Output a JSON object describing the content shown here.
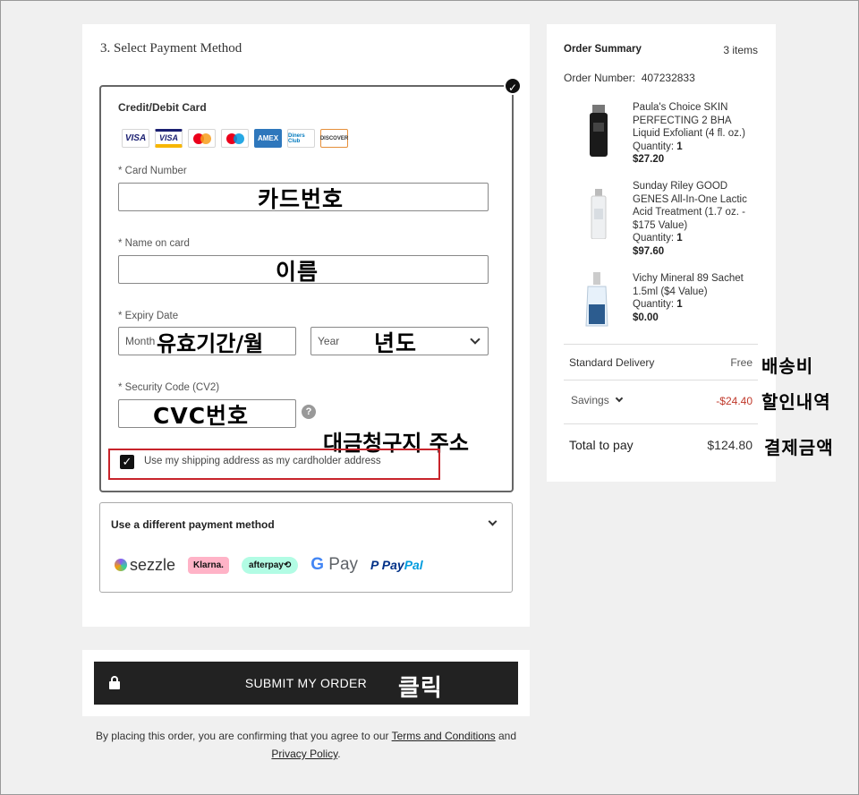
{
  "payment": {
    "section_title": "3. Select Payment Method",
    "card": {
      "title": "Credit/Debit Card",
      "logos": [
        "VISA",
        "VISA",
        "mastercard",
        "maestro",
        "AMEX",
        "Diners Club",
        "DISCOVER"
      ],
      "card_number_label": "* Card Number",
      "name_label": "* Name on card",
      "expiry_label": "* Expiry Date",
      "month_placeholder": "Month",
      "year_placeholder": "Year",
      "security_label": "* Security Code (CV2)",
      "help_glyph": "?",
      "use_shipping_label": "Use my shipping address as my cardholder address",
      "use_shipping_checked": true,
      "check_glyph": "✓"
    },
    "alt": {
      "title": "Use a different payment method",
      "sezzle": "sezzle",
      "klarna": "Klarna.",
      "afterpay": "afterpay⟲",
      "gpay_g": "G",
      "gpay_pay": " Pay",
      "paypal_pay": "Pay",
      "paypal_pal": "Pal"
    }
  },
  "annotations": {
    "card_number": "카드번호",
    "name": "이름",
    "expiry_month": "유효기간/월",
    "year": "년도",
    "cvc": "CVC번호",
    "billing_address": "대금청구지 주소",
    "click": "클릭",
    "shipping": "배송비",
    "discount": "할인내역",
    "total": "결제금액"
  },
  "submit": {
    "label": "SUBMIT MY ORDER"
  },
  "legal": {
    "prefix": "By placing this order, you are confirming that you agree to our ",
    "terms": "Terms and Conditions",
    "and": " and ",
    "privacy": "Privacy Policy",
    "suffix": "."
  },
  "summary": {
    "title": "Order Summary",
    "count": "3 items",
    "order_number_label": "Order Number:",
    "order_number": "407232833",
    "items": [
      {
        "name": "Paula's Choice SKIN PERFECTING 2 BHA Liquid Exfoliant (4 fl. oz.)",
        "quantity_label": "Quantity:",
        "quantity": "1",
        "price": "$27.20"
      },
      {
        "name": "Sunday Riley GOOD GENES All-In-One Lactic Acid Treatment (1.7 oz. - $175 Value)",
        "quantity_label": "Quantity:",
        "quantity": "1",
        "price": "$97.60"
      },
      {
        "name": "Vichy Mineral 89 Sachet 1.5ml ($4 Value)",
        "quantity_label": "Quantity:",
        "quantity": "1",
        "price": "$0.00"
      }
    ],
    "delivery_label": "Standard Delivery",
    "delivery_value": "Free",
    "savings_label": "Savings",
    "savings_value": "-$24.40",
    "total_label": "Total to pay",
    "total_value": "$124.80"
  },
  "colors": {
    "savings": "#c0392b",
    "highlight": "#c8242b",
    "button": "#222222"
  }
}
